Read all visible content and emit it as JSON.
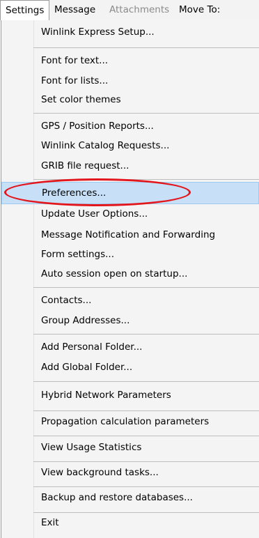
{
  "menubar": {
    "settings": "Settings",
    "message": "Message",
    "attachments": "Attachments",
    "move_to": "Move To:"
  },
  "menu": {
    "winlink_express_setup": "Winlink Express Setup...",
    "font_for_text": "Font for text...",
    "font_for_lists": "Font for lists...",
    "set_color_themes": "Set color themes",
    "gps_position_reports": "GPS / Position Reports...",
    "winlink_catalog_requests": "Winlink Catalog Requests...",
    "grib_file_request": "GRIB file request...",
    "preferences": "Preferences...",
    "update_user_options": "Update User Options...",
    "message_notification": "Message Notification and Forwarding",
    "form_settings": "Form settings...",
    "auto_session": "Auto session open on startup...",
    "contacts": "Contacts...",
    "group_addresses": "Group Addresses...",
    "add_personal_folder": "Add Personal Folder...",
    "add_global_folder": "Add Global Folder...",
    "hybrid_network_parameters": "Hybrid Network Parameters",
    "propagation_calculation_parameters": "Propagation calculation parameters",
    "view_usage_statistics": "View Usage Statistics",
    "view_background_tasks": "View background tasks...",
    "backup_restore_databases": "Backup and restore databases...",
    "exit": "Exit"
  },
  "selected_item": "preferences",
  "colors": {
    "selection_fill": "#c7e0f7",
    "selection_border": "#9ccaf1",
    "annotation_ring": "#e3161c"
  }
}
